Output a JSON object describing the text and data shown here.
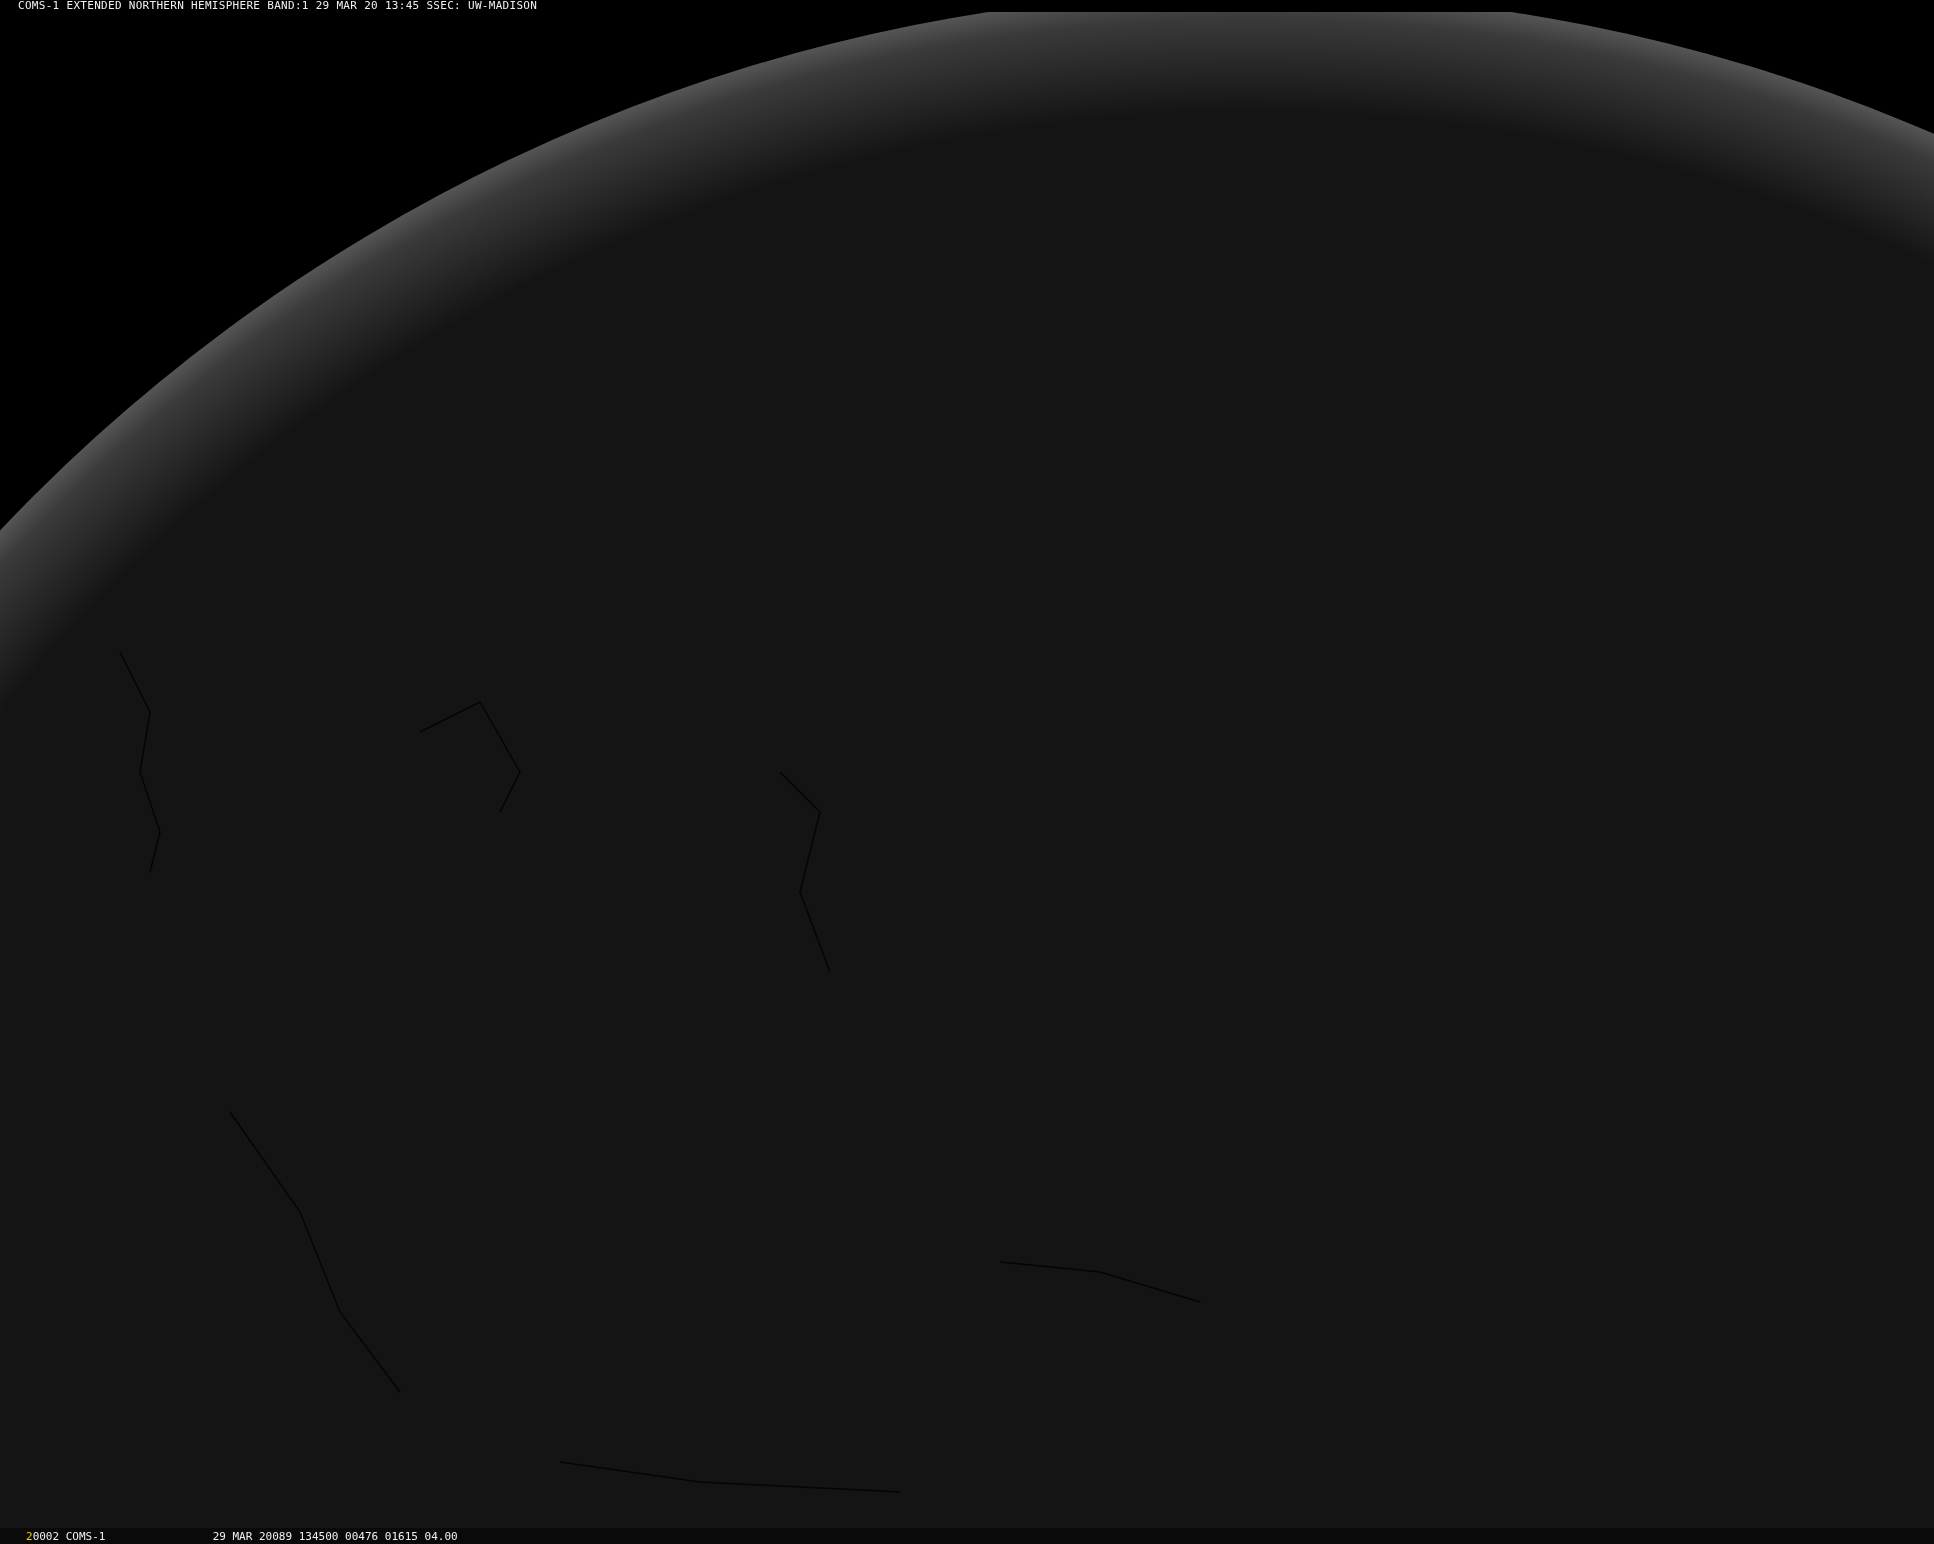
{
  "header": {
    "title": "COMS-1 EXTENDED NORTHERN HEMISPHERE BAND:1 29 MAR 20 13:45 SSEC: UW-MADISON"
  },
  "footer": {
    "frame": "2",
    "fields": [
      "0002 COMS-1",
      "29 MAR 20089 134500 00476 01615 04.00"
    ]
  }
}
